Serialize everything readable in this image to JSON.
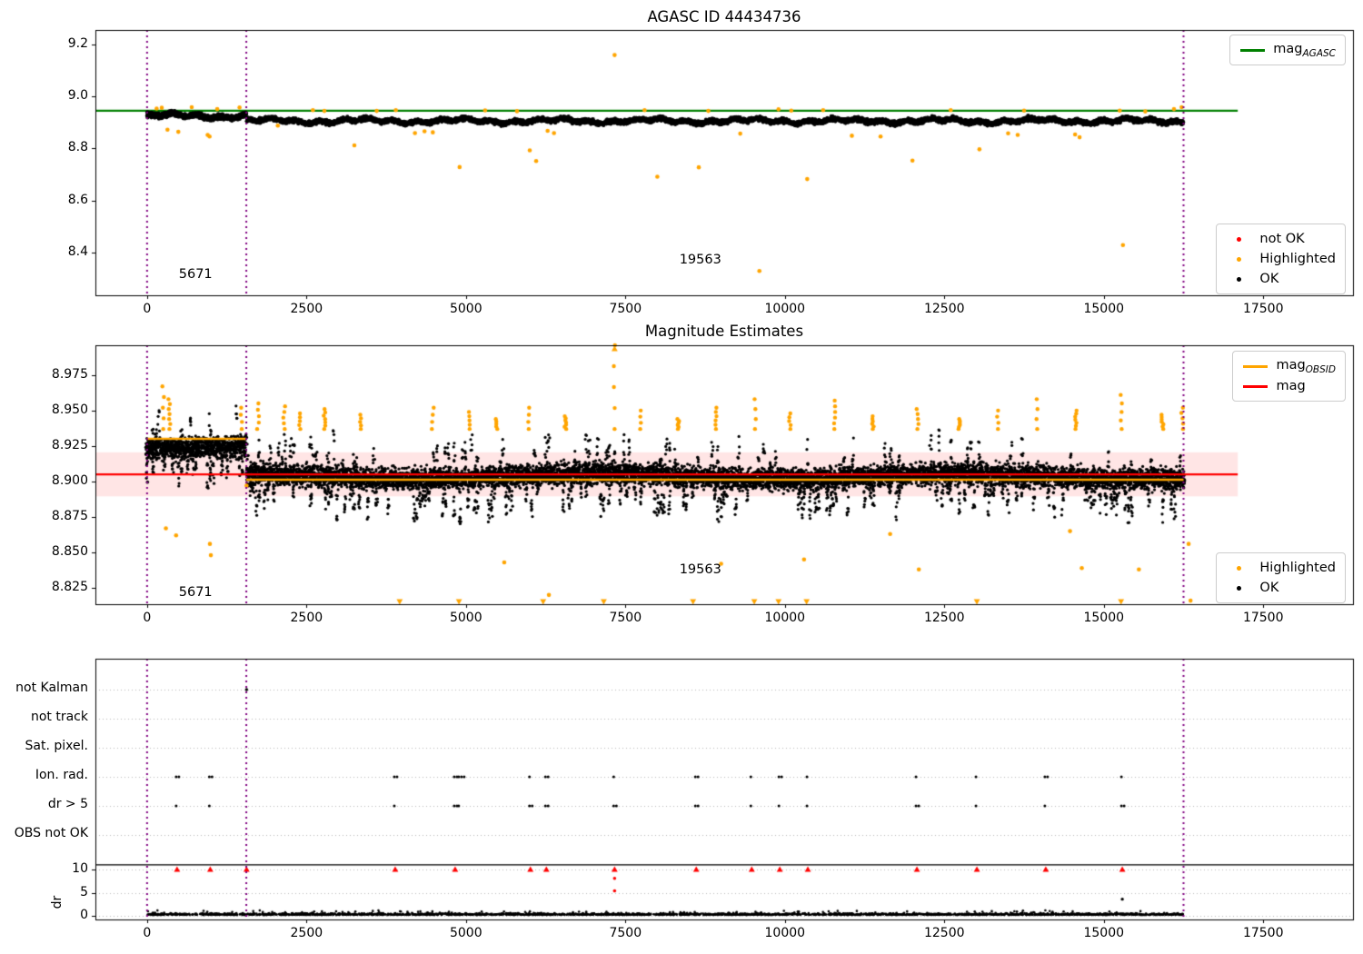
{
  "colors": {
    "ok": "#000000",
    "highlighted": "#ffa500",
    "not_ok": "#ff0000",
    "mag_agasc_line": "#008000",
    "mag_line": "#ff0000",
    "mag_obsid_line": "#ffa500",
    "obsid_boundary": "#800080",
    "mag_band_fill": "rgba(255,0,0,0.10)",
    "grid": "#bbbbbb",
    "divider": "#000000"
  },
  "titles": {
    "top": "AGASC ID 44434736",
    "middle": "Magnitude Estimates"
  },
  "legends": {
    "mag_agasc": {
      "main": "mag",
      "sub": "AGASC"
    },
    "mag_obsid": {
      "main": "mag",
      "sub": "OBSID"
    },
    "mag": {
      "label": "mag"
    },
    "p1_points": [
      {
        "label": "not OK",
        "swatch": "not_ok"
      },
      {
        "label": "Highlighted",
        "swatch": "highlighted"
      },
      {
        "label": "OK",
        "swatch": "ok"
      }
    ],
    "p2_points": [
      {
        "label": "Highlighted",
        "swatch": "highlighted"
      },
      {
        "label": "OK",
        "swatch": "ok"
      }
    ]
  },
  "chart_data": [
    {
      "type": "scatter",
      "title": "AGASC ID 44434736",
      "xlim": [
        -810,
        18907
      ],
      "ylim": [
        8.238,
        9.254
      ],
      "xticks": {
        "values": [
          0,
          2500,
          5000,
          7500,
          10000,
          12500,
          15000,
          17500
        ],
        "labels": [
          "0",
          "2500",
          "5000",
          "7500",
          "10000",
          "12500",
          "15000",
          "17500"
        ]
      },
      "yticks": {
        "values": [
          8.4,
          8.6,
          8.8,
          9.0,
          9.2
        ],
        "labels": [
          "8.4",
          "8.6",
          "8.8",
          "9.0",
          "9.2"
        ]
      },
      "mag_agasc": 8.945,
      "line_x_extent": [
        -810,
        17100
      ],
      "obsid_boundaries": [
        0,
        1556,
        16250
      ],
      "ok_scatter": [
        {
          "x0": 0,
          "x1": 1556,
          "mean": 8.9245,
          "spread": 0.016,
          "n": 950
        },
        {
          "x0": 1556,
          "x1": 16250,
          "mean": 8.9055,
          "spread": 0.015,
          "n": 5800
        }
      ],
      "highlighted": [
        [
          150,
          8.953
        ],
        [
          230,
          8.956
        ],
        [
          700,
          8.958
        ],
        [
          1100,
          8.951
        ],
        [
          1450,
          8.957
        ],
        [
          320,
          8.872
        ],
        [
          490,
          8.864
        ],
        [
          950,
          8.852
        ],
        [
          980,
          8.846
        ],
        [
          2050,
          8.888
        ],
        [
          2600,
          8.947
        ],
        [
          2780,
          8.944
        ],
        [
          3250,
          8.812
        ],
        [
          3600,
          8.944
        ],
        [
          3900,
          8.947
        ],
        [
          4200,
          8.859
        ],
        [
          4350,
          8.866
        ],
        [
          4480,
          8.862
        ],
        [
          4900,
          8.729
        ],
        [
          5300,
          8.946
        ],
        [
          5800,
          8.943
        ],
        [
          6000,
          8.793
        ],
        [
          6100,
          8.752
        ],
        [
          6280,
          8.868
        ],
        [
          6380,
          8.859
        ],
        [
          7330,
          9.158
        ],
        [
          7800,
          8.947
        ],
        [
          8000,
          8.692
        ],
        [
          8650,
          8.728
        ],
        [
          8800,
          8.944
        ],
        [
          9300,
          8.857
        ],
        [
          9600,
          8.331
        ],
        [
          9900,
          8.95
        ],
        [
          10100,
          8.945
        ],
        [
          10350,
          8.683
        ],
        [
          10600,
          8.947
        ],
        [
          11050,
          8.849
        ],
        [
          11500,
          8.846
        ],
        [
          12000,
          8.754
        ],
        [
          12600,
          8.947
        ],
        [
          13050,
          8.797
        ],
        [
          13500,
          8.858
        ],
        [
          13650,
          8.852
        ],
        [
          13750,
          8.945
        ],
        [
          14550,
          8.854
        ],
        [
          14620,
          8.843
        ],
        [
          15250,
          8.945
        ],
        [
          15300,
          8.43
        ],
        [
          15650,
          8.942
        ],
        [
          16100,
          8.951
        ],
        [
          16220,
          8.958
        ]
      ],
      "annotations": [
        {
          "text": "5671",
          "x": 760,
          "y": 8.315
        },
        {
          "text": "19563",
          "x": 8675,
          "y": 8.37
        }
      ]
    },
    {
      "type": "scatter",
      "title": "Magnitude Estimates",
      "xlim": [
        -810,
        18907
      ],
      "ylim": [
        8.8135,
        8.996
      ],
      "xticks": {
        "values": [
          0,
          2500,
          5000,
          7500,
          10000,
          12500,
          15000,
          17500
        ],
        "labels": [
          "0",
          "2500",
          "5000",
          "7500",
          "10000",
          "12500",
          "15000",
          "17500"
        ]
      },
      "yticks": {
        "values": [
          8.825,
          8.85,
          8.875,
          8.9,
          8.925,
          8.95,
          8.975
        ],
        "labels": [
          "8.825",
          "8.850",
          "8.875",
          "8.900",
          "8.925",
          "8.950",
          "8.975"
        ]
      },
      "mag": 8.905,
      "mag_band": [
        8.8895,
        8.9205
      ],
      "line_x_extent": [
        -810,
        17100
      ],
      "mag_obsid": [
        {
          "x0": 0,
          "x1": 1556,
          "y": 8.93
        },
        {
          "x0": 1556,
          "x1": 16250,
          "y": 8.9012
        }
      ],
      "obsid_boundaries": [
        0,
        1556,
        16250
      ],
      "ok_columns": {
        "x0": 0,
        "x1": 16250,
        "step": 45,
        "boundary": 1556,
        "mean_before": 8.9225,
        "mean_after": 8.9035,
        "core": 0.011
      },
      "highlight_columns": [
        [
          250,
          8.967
        ],
        [
          350,
          8.958
        ],
        [
          1480,
          8.952
        ],
        [
          1740,
          8.955
        ],
        [
          2150,
          8.953
        ],
        [
          2400,
          8.948
        ],
        [
          2780,
          8.951
        ],
        [
          3350,
          8.947
        ],
        [
          4480,
          8.952
        ],
        [
          5050,
          8.949
        ],
        [
          5480,
          8.944
        ],
        [
          5980,
          8.952
        ],
        [
          6560,
          8.946
        ],
        [
          7330,
          8.996
        ],
        [
          7740,
          8.95
        ],
        [
          8330,
          8.944
        ],
        [
          8920,
          8.952
        ],
        [
          9530,
          8.958
        ],
        [
          10080,
          8.948
        ],
        [
          10780,
          8.957
        ],
        [
          11380,
          8.946
        ],
        [
          12080,
          8.951
        ],
        [
          12730,
          8.944
        ],
        [
          13340,
          8.95
        ],
        [
          13960,
          8.958
        ],
        [
          14560,
          8.95
        ],
        [
          15270,
          8.961
        ],
        [
          15920,
          8.947
        ],
        [
          16230,
          8.952
        ]
      ],
      "highlighted": [
        [
          295,
          8.867
        ],
        [
          455,
          8.862
        ],
        [
          985,
          8.856
        ],
        [
          1000,
          8.848
        ],
        [
          1560,
          8.897
        ],
        [
          5600,
          8.843
        ],
        [
          6300,
          8.82
        ],
        [
          9000,
          8.842
        ],
        [
          10300,
          8.845
        ],
        [
          11650,
          8.863
        ],
        [
          12100,
          8.838
        ],
        [
          14470,
          8.865
        ],
        [
          14655,
          8.839
        ],
        [
          15550,
          8.838
        ],
        [
          16330,
          8.856
        ],
        [
          16360,
          8.816
        ]
      ],
      "clip_low_x": [
        3960,
        4890,
        6210,
        7160,
        8560,
        9520,
        9900,
        10340,
        13010,
        15270
      ],
      "clip_high_x": [
        7330
      ],
      "annotations": [
        {
          "text": "5671",
          "x": 760,
          "y": 8.8215
        },
        {
          "text": "19563",
          "x": 8675,
          "y": 8.837
        }
      ]
    },
    {
      "type": "flags",
      "rows": [
        "not Kalman",
        "not track",
        "Sat. pixel.",
        "Ion. rad.",
        "dr > 5",
        "OBS not OK"
      ],
      "dr_label": "dr",
      "dr_ticks": {
        "values": [
          0,
          5,
          10
        ],
        "labels": [
          "0",
          "5",
          "10"
        ]
      },
      "xticks": {
        "values": [
          0,
          2500,
          5000,
          7500,
          10000,
          12500,
          15000,
          17500
        ],
        "labels": [
          "0",
          "2500",
          "5000",
          "7500",
          "10000",
          "12500",
          "15000",
          "17500"
        ]
      },
      "flag_events_x": [
        470,
        990,
        3890,
        4830,
        4900,
        6010,
        6260,
        7330,
        8610,
        9480,
        9920,
        10360,
        12070,
        13010,
        14090,
        15290
      ],
      "flag_rows_with_events": [
        "Ion. rad.",
        "dr > 5"
      ],
      "not_kalman_x": [
        1560
      ],
      "dr_clip_x": [
        470,
        990,
        1560,
        3890,
        4830,
        6010,
        6260,
        7330,
        8610,
        9480,
        9920,
        10360,
        12070,
        13010,
        14090,
        15290
      ],
      "dr_clip_value": 10,
      "dr_red_points": [
        [
          7330,
          8.1
        ],
        [
          7330,
          5.4
        ]
      ],
      "dr_black_points": [
        [
          15290,
          3.6
        ]
      ],
      "dr_band": {
        "x0": 0,
        "x1": 16250,
        "max": 1.2
      },
      "divider_dr": 11,
      "obsid_boundaries": [
        0,
        1556,
        16250
      ]
    }
  ]
}
